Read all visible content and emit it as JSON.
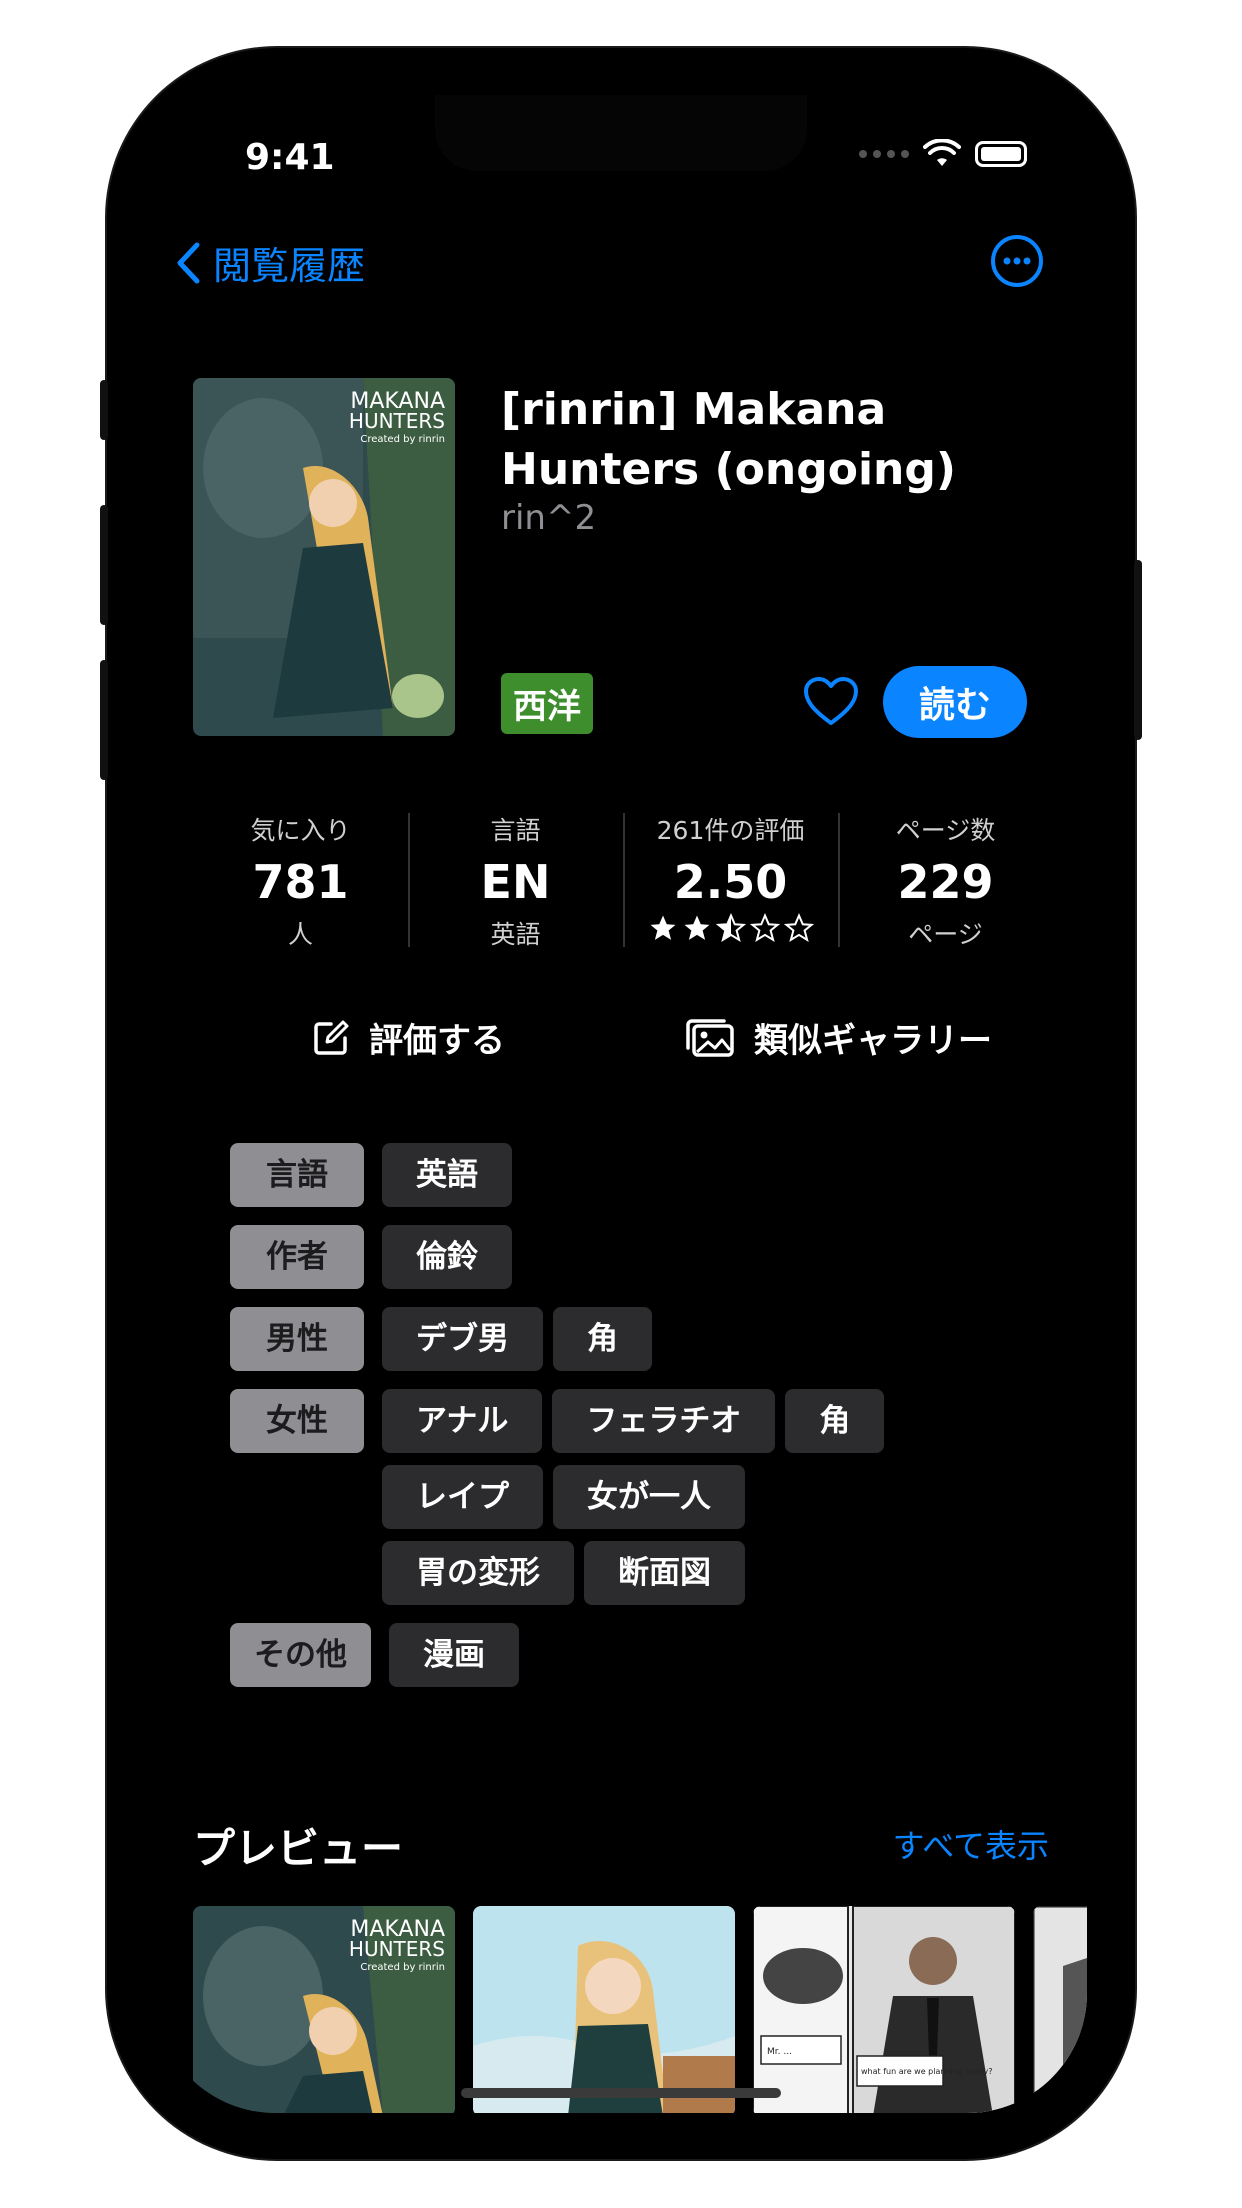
{
  "status_bar": {
    "time": "9:41"
  },
  "nav": {
    "back_label": "閲覧履歴",
    "more_icon": "ellipsis-circle-icon"
  },
  "gallery": {
    "title": "[rinrin] Makana Hunters (ongoing)",
    "artist": "rin^2",
    "category": "西洋",
    "read_label": "読む",
    "cover_text": {
      "line1": "MAKANA",
      "line2": "HUNTERS",
      "line3": "Created by rinrin"
    }
  },
  "stats": [
    {
      "label": "気に入り",
      "value": "781",
      "sub": "人"
    },
    {
      "label": "言語",
      "value": "EN",
      "sub": "英語"
    },
    {
      "label": "261件の評価",
      "value": "2.50",
      "rating": 2.5
    },
    {
      "label": "ページ数",
      "value": "229",
      "sub": "ページ"
    }
  ],
  "actions": {
    "rate_label": "評価する",
    "similar_label": "類似ギャラリー"
  },
  "tags": [
    {
      "namespace": "言語",
      "values": [
        "英語"
      ]
    },
    {
      "namespace": "作者",
      "values": [
        "倫鈴"
      ]
    },
    {
      "namespace": "男性",
      "values": [
        "デブ男",
        "角"
      ]
    },
    {
      "namespace": "女性",
      "values": [
        "アナル",
        "フェラチオ",
        "角",
        "レイプ",
        "女が一人",
        "胃の変形",
        "断面図"
      ]
    },
    {
      "namespace": "その他",
      "values": [
        "漫画"
      ]
    }
  ],
  "preview": {
    "title": "プレビュー",
    "see_all": "すべて表示",
    "thumb3_text": {
      "a": "Mr. ...",
      "b": "what fun are we planning today?"
    }
  },
  "colors": {
    "accent": "#0a84ff",
    "category": "#3f8e2e",
    "tag_bg": "#2c2c2e",
    "namespace_bg": "#8e8e93"
  }
}
